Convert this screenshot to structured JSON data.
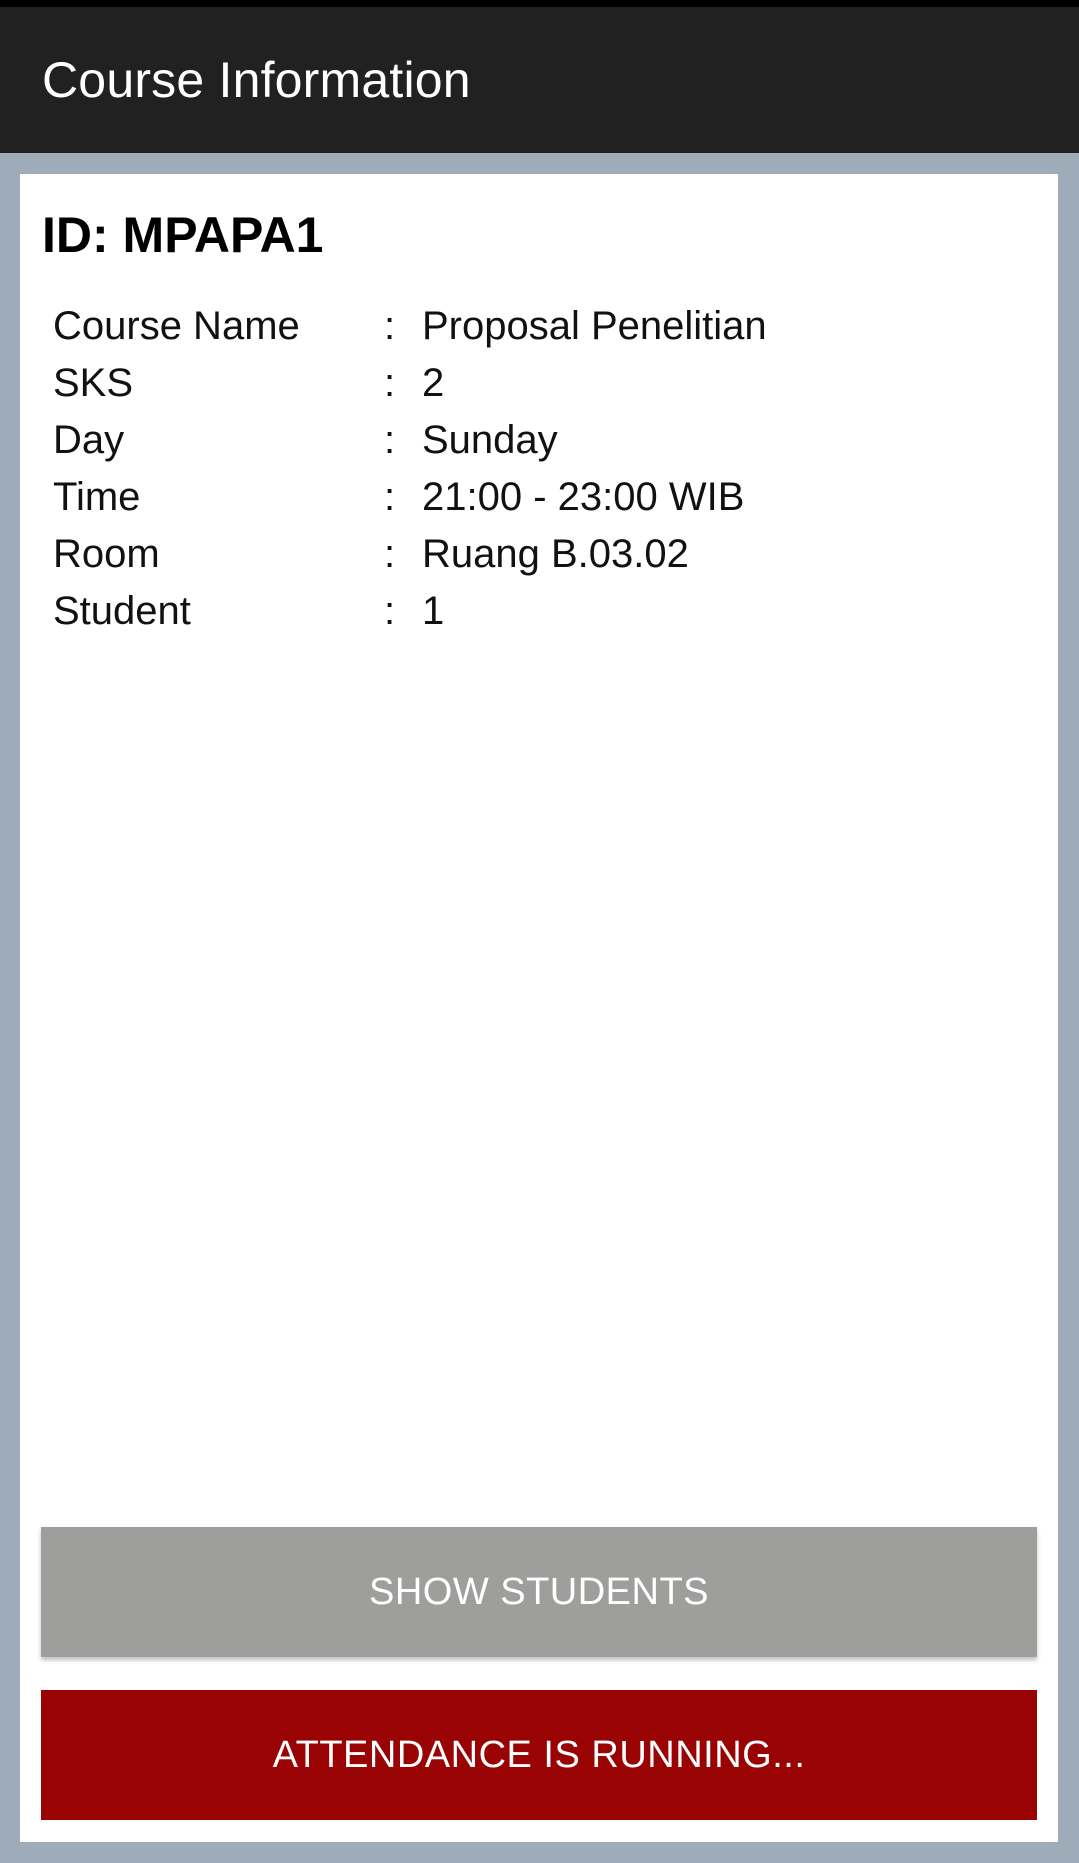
{
  "app_bar": {
    "title": "Course Information"
  },
  "course": {
    "id_text": "ID: MPAPA1",
    "separator": ":",
    "fields": [
      {
        "label": "Course Name",
        "value": "Proposal Penelitian"
      },
      {
        "label": "SKS",
        "value": "2"
      },
      {
        "label": "Day",
        "value": "Sunday"
      },
      {
        "label": "Time",
        "value": "21:00 - 23:00 WIB"
      },
      {
        "label": "Room",
        "value": "Ruang B.03.02"
      },
      {
        "label": "Student",
        "value": "1"
      }
    ]
  },
  "buttons": {
    "show_students": "SHOW STUDENTS",
    "attendance": "ATTENDANCE IS RUNNING..."
  },
  "colors": {
    "app_bar": "#212121",
    "background": "#9eabb8",
    "card": "#ffffff",
    "show_button": "#9e9e9c",
    "attendance_button": "#990304"
  }
}
